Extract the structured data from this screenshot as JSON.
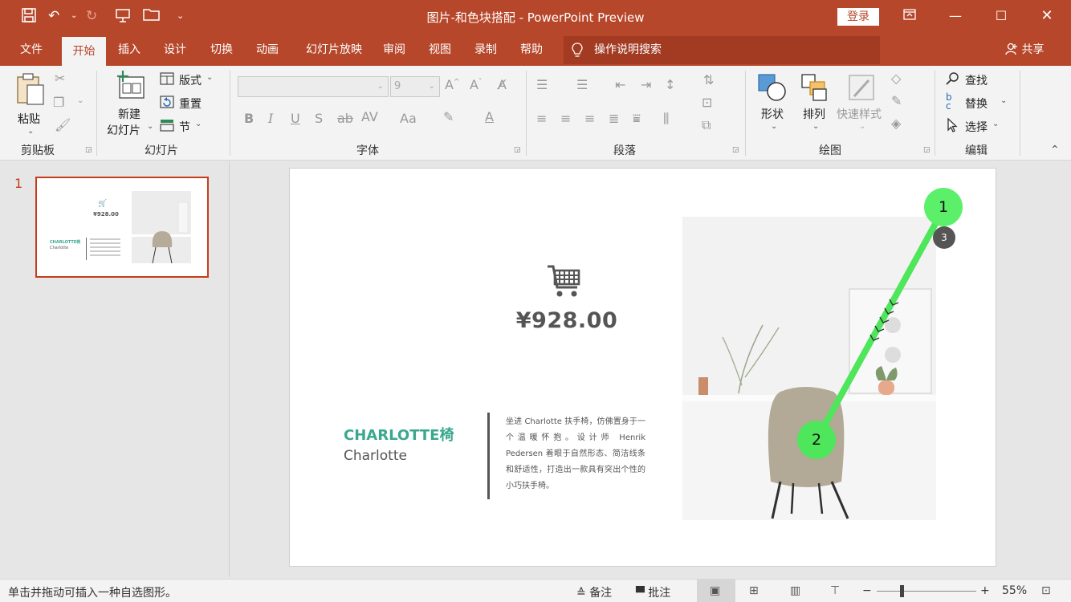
{
  "titlebar": {
    "title": "图片-和色块搭配  -  PowerPoint Preview",
    "login": "登录"
  },
  "tabs": [
    "文件",
    "开始",
    "插入",
    "设计",
    "切换",
    "动画",
    "幻灯片放映",
    "审阅",
    "视图",
    "录制",
    "帮助"
  ],
  "active_tab": "开始",
  "tellme": "操作说明搜索",
  "share": "共享",
  "ribbon": {
    "clipboard": {
      "paste": "粘贴",
      "label": "剪贴板"
    },
    "slides": {
      "new_slide_1": "新建",
      "new_slide_2": "幻灯片",
      "layout": "版式",
      "reset": "重置",
      "section": "节",
      "label": "幻灯片"
    },
    "font": {
      "size": "9",
      "label": "字体"
    },
    "paragraph": {
      "label": "段落"
    },
    "drawing": {
      "shapes": "形状",
      "arrange": "排列",
      "quick_styles": "快速样式",
      "label": "绘图"
    },
    "editing": {
      "find": "查找",
      "replace": "替换",
      "select": "选择",
      "label": "编辑"
    }
  },
  "thumbnail": {
    "number": "1",
    "price": "¥928.00",
    "title": "CHARLOTTE椅",
    "subtitle": "Charlotte"
  },
  "slide": {
    "price": "¥928.00",
    "title": "CHARLOTTE椅",
    "subtitle": "Charlotte",
    "description": "坐进 Charlotte 扶手椅，仿佛置身于一个温暖怀抱。设计师 Henrik Pedersen 着眼于自然形态、简洁线条和舒适性，打造出一款具有突出个性的小巧扶手椅。"
  },
  "annotations": {
    "start": "1",
    "end": "2",
    "step": "3"
  },
  "statusbar": {
    "hint": "单击并拖动可插入一种自选图形。",
    "notes": "备注",
    "comments": "批注",
    "zoom": "55%"
  },
  "colors": {
    "accent": "#b7472a",
    "teal": "#3aa88f",
    "drag_line": "#4ee65a"
  }
}
